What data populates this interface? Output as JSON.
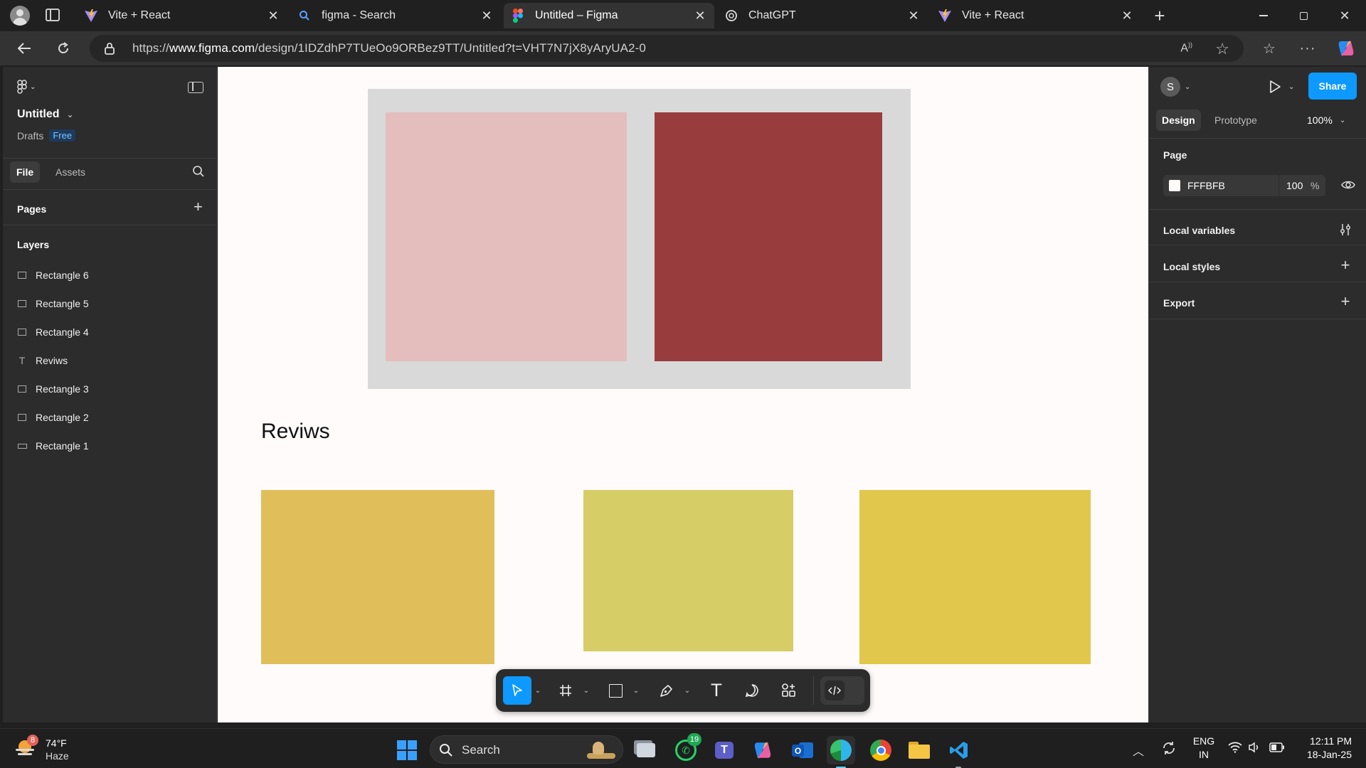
{
  "browser": {
    "tabs": [
      {
        "title": "Vite + React",
        "icon": "vite-icon"
      },
      {
        "title": "figma - Search",
        "icon": "search-icon"
      },
      {
        "title": "Untitled – Figma",
        "icon": "figma-icon",
        "active": true
      },
      {
        "title": "ChatGPT",
        "icon": "chatgpt-icon"
      },
      {
        "title": "Vite + React",
        "icon": "vite-icon"
      }
    ],
    "url_prefix": "https://",
    "url_domain": "www.figma.com",
    "url_path": "/design/1IDZdhP7TUeOo9ORBez9TT/Untitled?t=VHT7N7jX8yAryUA2-0"
  },
  "figma": {
    "file_name": "Untitled",
    "location": "Drafts",
    "plan_badge": "Free",
    "tabs": {
      "file": "File",
      "assets": "Assets"
    },
    "pages_label": "Pages",
    "layers_label": "Layers",
    "layers": [
      {
        "name": "Rectangle 6",
        "type": "rect"
      },
      {
        "name": "Rectangle 5",
        "type": "rect"
      },
      {
        "name": "Rectangle 4",
        "type": "rect"
      },
      {
        "name": "Reviws",
        "type": "text"
      },
      {
        "name": "Rectangle 3",
        "type": "rect"
      },
      {
        "name": "Rectangle 2",
        "type": "rect"
      },
      {
        "name": "Rectangle 1",
        "type": "rect-wide"
      }
    ],
    "avatar_initial": "S",
    "share_label": "Share",
    "mode_tabs": {
      "design": "Design",
      "prototype": "Prototype"
    },
    "zoom": "100%",
    "page_section": "Page",
    "page_color": "FFFBFB",
    "page_opacity": "100",
    "percent_sign": "%",
    "local_variables": "Local variables",
    "local_styles": "Local styles",
    "export": "Export",
    "help": "?",
    "canvas_text": "Reviws",
    "colors": {
      "frame_bg": "#d9d9d9",
      "rect_pink": "#e4bdbd",
      "rect_dark": "#983c3e",
      "rect_yellow1": "#e0bf5b",
      "rect_yellow2": "#d7cd67",
      "rect_yellow3": "#e1c74c",
      "accent": "#0d99ff"
    }
  },
  "taskbar": {
    "weather_temp": "74°F",
    "weather_desc": "Haze",
    "weather_badge": "8",
    "search_placeholder": "Search",
    "whatsapp_badge": "19",
    "lang_line1": "ENG",
    "lang_line2": "IN",
    "time": "12:11 PM",
    "date": "18-Jan-25"
  }
}
